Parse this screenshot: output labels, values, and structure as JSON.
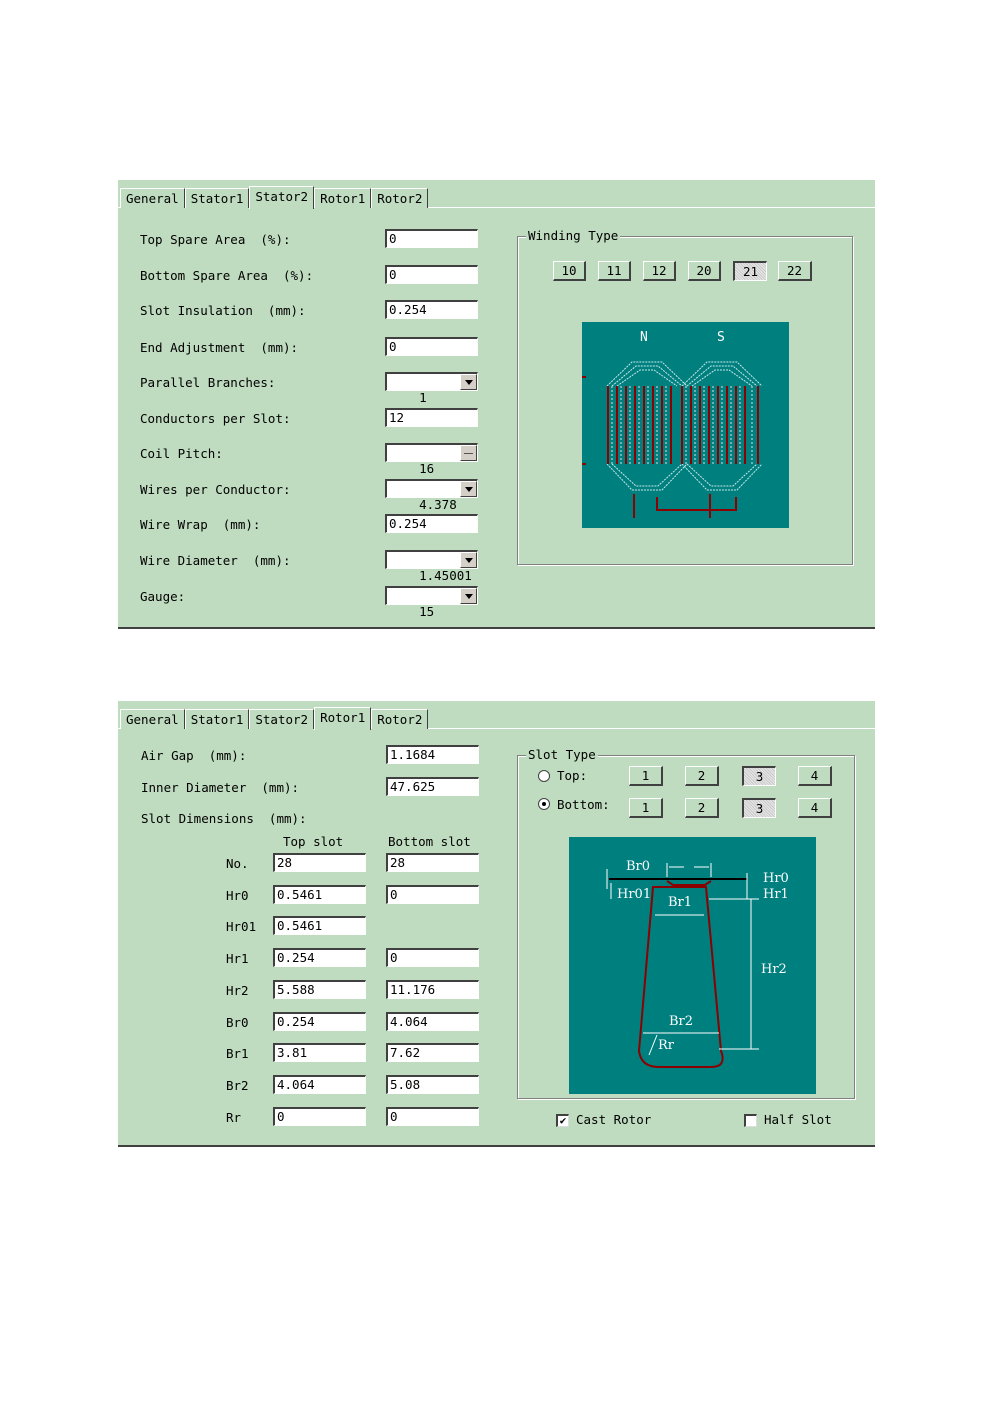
{
  "stator2_panel": {
    "tabs": [
      "General",
      "Stator1",
      "Stator2",
      "Rotor1",
      "Rotor2"
    ],
    "active_tab": "Stator2",
    "fields": [
      {
        "label": "Top Spare Area  (%):",
        "value": "0"
      },
      {
        "label": "Bottom Spare Area  (%):",
        "value": "0"
      },
      {
        "label": "Slot Insulation  (mm):",
        "value": "0.254"
      },
      {
        "label": "End Adjustment  (mm):",
        "value": "0"
      },
      {
        "label": "Parallel Branches:",
        "value": "1"
      },
      {
        "label": "Conductors per Slot:",
        "value": "12"
      },
      {
        "label": "Coil Pitch:",
        "value": "16"
      },
      {
        "label": "Wires per Conductor:",
        "value": "4.378"
      },
      {
        "label": "Wire Wrap  (mm):",
        "value": "0.254"
      },
      {
        "label": "Wire Diameter  (mm):",
        "value": "1.45001"
      },
      {
        "label": "Gauge:",
        "value": "15"
      }
    ],
    "winding_type": {
      "title": "Winding Type",
      "buttons": [
        "10",
        "11",
        "12",
        "20",
        "21",
        "22"
      ],
      "selected": "21",
      "pole_labels": [
        "N",
        "S"
      ]
    }
  },
  "rotor1_panel": {
    "tabs": [
      "General",
      "Stator1",
      "Stator2",
      "Rotor1",
      "Rotor2"
    ],
    "active_tab": "Rotor1",
    "air_gap_label": "Air Gap  (mm):",
    "air_gap_value": "1.1684",
    "inner_diameter_label": "Inner Diameter  (mm):",
    "inner_diameter_value": "47.625",
    "slot_dimensions_label": "Slot Dimensions  (mm):",
    "col_top": "Top slot",
    "col_bottom": "Bottom slot",
    "rows": [
      {
        "name": "No.",
        "top": "28",
        "bottom": "28"
      },
      {
        "name": "Hr0",
        "top": "0.5461",
        "bottom": "0"
      },
      {
        "name": "Hr01",
        "top": "0.5461",
        "bottom": ""
      },
      {
        "name": "Hr1",
        "top": "0.254",
        "bottom": "0"
      },
      {
        "name": "Hr2",
        "top": "5.588",
        "bottom": "11.176"
      },
      {
        "name": "Br0",
        "top": "0.254",
        "bottom": "4.064"
      },
      {
        "name": "Br1",
        "top": "3.81",
        "bottom": "7.62"
      },
      {
        "name": "Br2",
        "top": "4.064",
        "bottom": "5.08"
      },
      {
        "name": "Rr",
        "top": "0",
        "bottom": "0"
      }
    ],
    "slot_type": {
      "title": "Slot Type",
      "top_label": "Top:",
      "bottom_label": "Bottom:",
      "selected_radio": "Bottom",
      "buttons": [
        "1",
        "2",
        "3",
        "4"
      ],
      "top_selected": "3",
      "bottom_selected": "3"
    },
    "diagram_labels": {
      "br0": "Br0",
      "hr0": "Hr0",
      "hr01": "Hr01",
      "hr1": "Hr1",
      "br1": "Br1",
      "hr2": "Hr2",
      "br2": "Br2",
      "rr": "Rr"
    },
    "cast_rotor_label": "Cast Rotor",
    "cast_rotor_checked": true,
    "half_slot_label": "Half Slot",
    "half_slot_checked": false
  }
}
